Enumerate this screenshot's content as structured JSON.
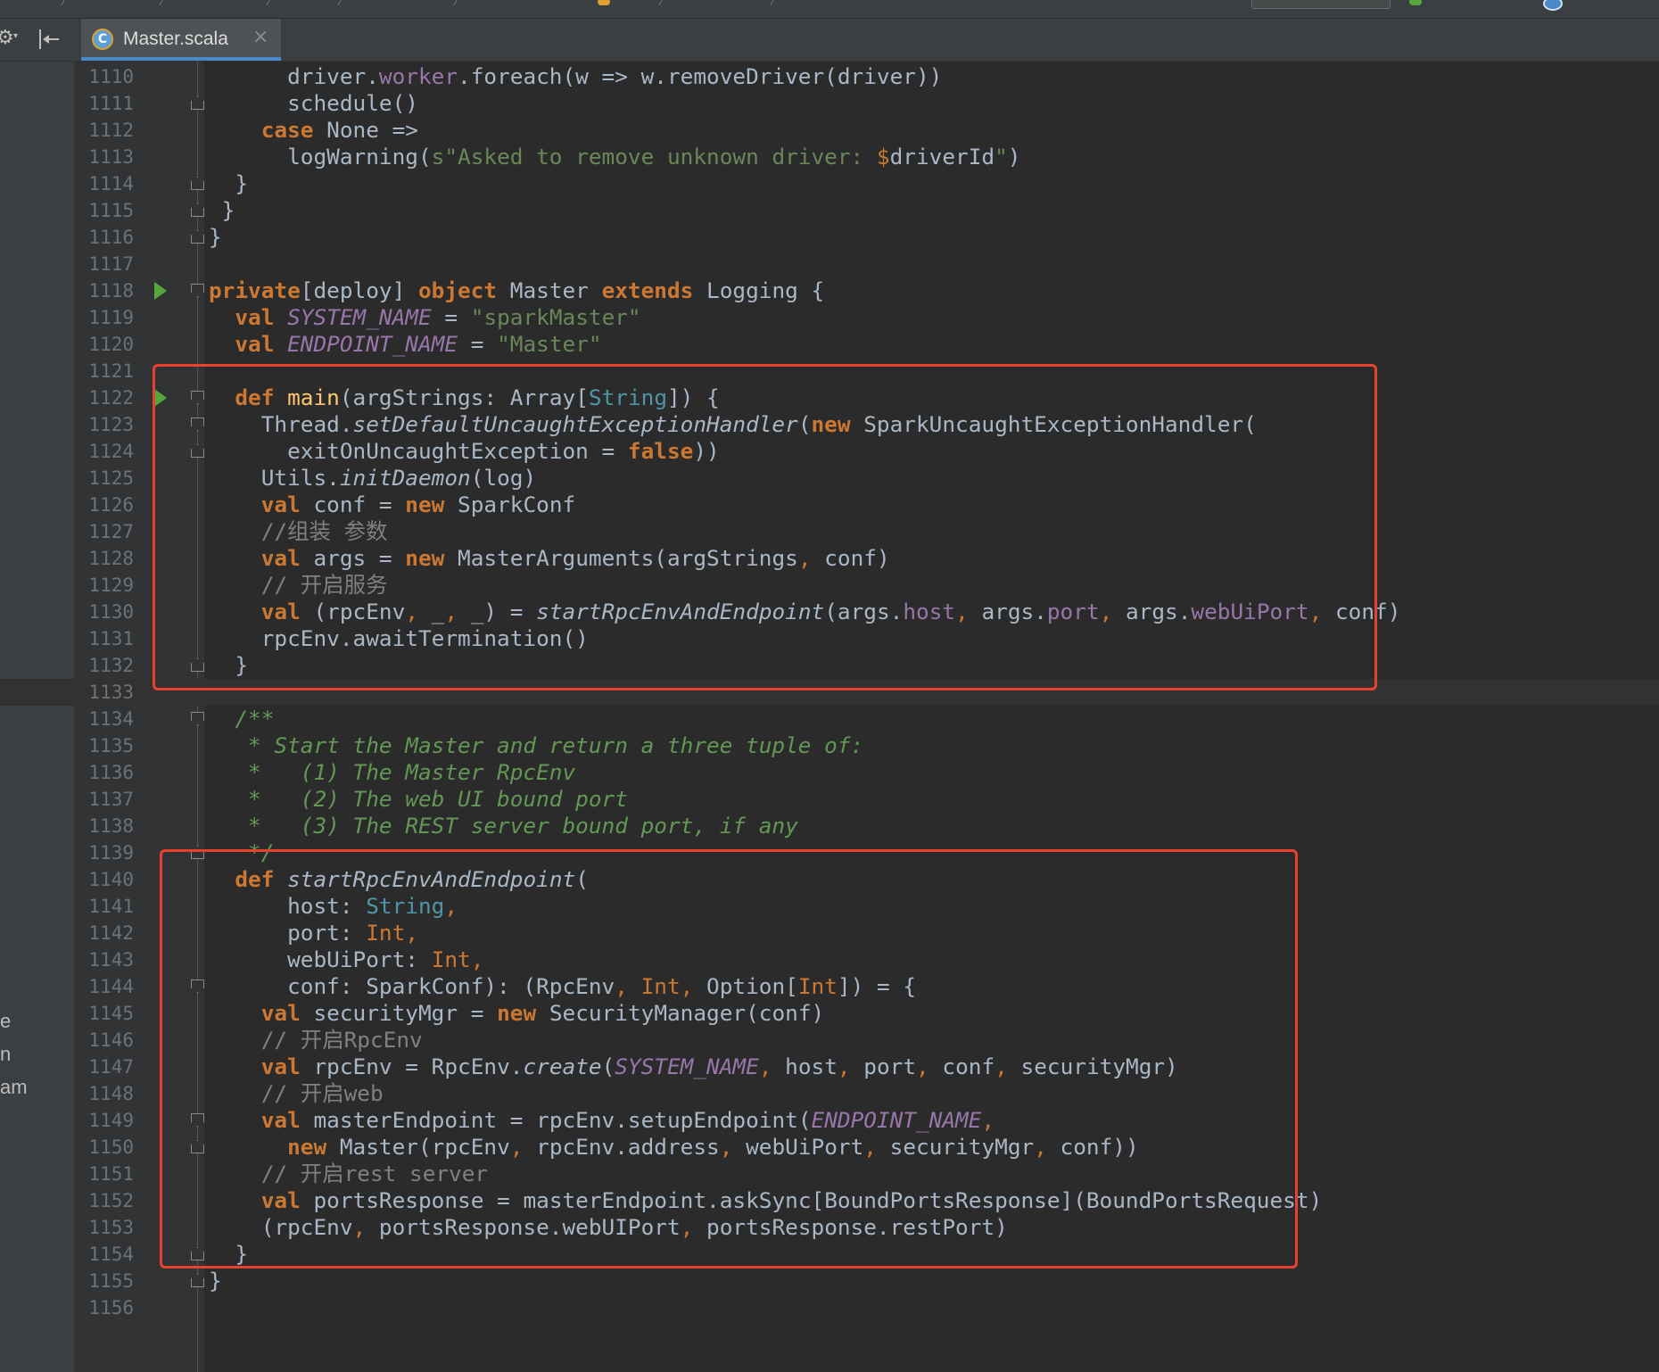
{
  "editor": {
    "active_tab": {
      "label": "Master.scala",
      "icon": "scala-class-icon",
      "close_glyph": "×"
    },
    "toolbar_icons": [
      "gear-icon",
      "collapse-sidebar-icon"
    ]
  },
  "left_panel": {
    "clipped_text": [
      "e",
      "n",
      "am"
    ]
  },
  "theme": {
    "background": "#2b2b2b",
    "keyword": "#cc7832",
    "string": "#6a8759",
    "field": "#9876aa",
    "doc_comment": "#629755",
    "highlight_box": "#e8422f"
  },
  "code": {
    "lines": [
      {
        "num": "1110",
        "text": "      driver.worker.foreach(w => w.removeDriver(driver))"
      },
      {
        "num": "1111",
        "text": "      schedule()"
      },
      {
        "num": "1112",
        "text": "    case None =>"
      },
      {
        "num": "1113",
        "text": "      logWarning(s\"Asked to remove unknown driver: $driverId\")"
      },
      {
        "num": "1114",
        "text": "  }"
      },
      {
        "num": "1115",
        "text": " }"
      },
      {
        "num": "1116",
        "text": "}"
      },
      {
        "num": "1117",
        "text": ""
      },
      {
        "num": "1118",
        "text": "private[deploy] object Master extends Logging {"
      },
      {
        "num": "1119",
        "text": "  val SYSTEM_NAME = \"sparkMaster\""
      },
      {
        "num": "1120",
        "text": "  val ENDPOINT_NAME = \"Master\""
      },
      {
        "num": "1121",
        "text": ""
      },
      {
        "num": "1122",
        "text": "  def main(argStrings: Array[String]) {"
      },
      {
        "num": "1123",
        "text": "    Thread.setDefaultUncaughtExceptionHandler(new SparkUncaughtExceptionHandler("
      },
      {
        "num": "1124",
        "text": "      exitOnUncaughtException = false))"
      },
      {
        "num": "1125",
        "text": "    Utils.initDaemon(log)"
      },
      {
        "num": "1126",
        "text": "    val conf = new SparkConf"
      },
      {
        "num": "1127",
        "text": "    //组装 参数"
      },
      {
        "num": "1128",
        "text": "    val args = new MasterArguments(argStrings, conf)"
      },
      {
        "num": "1129",
        "text": "    // 开启服务"
      },
      {
        "num": "1130",
        "text": "    val (rpcEnv, _, _) = startRpcEnvAndEndpoint(args.host, args.port, args.webUiPort, conf)"
      },
      {
        "num": "1131",
        "text": "    rpcEnv.awaitTermination()"
      },
      {
        "num": "1132",
        "text": "  }"
      },
      {
        "num": "1133",
        "text": ""
      },
      {
        "num": "1134",
        "text": "  /**"
      },
      {
        "num": "1135",
        "text": "   * Start the Master and return a three tuple of:"
      },
      {
        "num": "1136",
        "text": "   *   (1) The Master RpcEnv"
      },
      {
        "num": "1137",
        "text": "   *   (2) The web UI bound port"
      },
      {
        "num": "1138",
        "text": "   *   (3) The REST server bound port, if any"
      },
      {
        "num": "1139",
        "text": "   */"
      },
      {
        "num": "1140",
        "text": "  def startRpcEnvAndEndpoint("
      },
      {
        "num": "1141",
        "text": "      host: String,"
      },
      {
        "num": "1142",
        "text": "      port: Int,"
      },
      {
        "num": "1143",
        "text": "      webUiPort: Int,"
      },
      {
        "num": "1144",
        "text": "      conf: SparkConf): (RpcEnv, Int, Option[Int]) = {"
      },
      {
        "num": "1145",
        "text": "    val securityMgr = new SecurityManager(conf)"
      },
      {
        "num": "1146",
        "text": "    // 开启RpcEnv"
      },
      {
        "num": "1147",
        "text": "    val rpcEnv = RpcEnv.create(SYSTEM_NAME, host, port, conf, securityMgr)"
      },
      {
        "num": "1148",
        "text": "    // 开启web"
      },
      {
        "num": "1149",
        "text": "    val masterEndpoint = rpcEnv.setupEndpoint(ENDPOINT_NAME,"
      },
      {
        "num": "1150",
        "text": "      new Master(rpcEnv, rpcEnv.address, webUiPort, securityMgr, conf))"
      },
      {
        "num": "1151",
        "text": "    // 开启rest server"
      },
      {
        "num": "1152",
        "text": "    val portsResponse = masterEndpoint.askSync[BoundPortsResponse](BoundPortsRequest)"
      },
      {
        "num": "1153",
        "text": "    (rpcEnv, portsResponse.webUIPort, portsResponse.restPort)"
      },
      {
        "num": "1154",
        "text": "  }"
      },
      {
        "num": "1155",
        "text": "}"
      },
      {
        "num": "1156",
        "text": ""
      }
    ]
  },
  "highlight_boxes": [
    {
      "label": "main-method-box",
      "from_line": "1122",
      "to_line": "1132"
    },
    {
      "label": "start-rpc-env-method-box",
      "from_line": "1140",
      "to_line": "1154"
    }
  ]
}
